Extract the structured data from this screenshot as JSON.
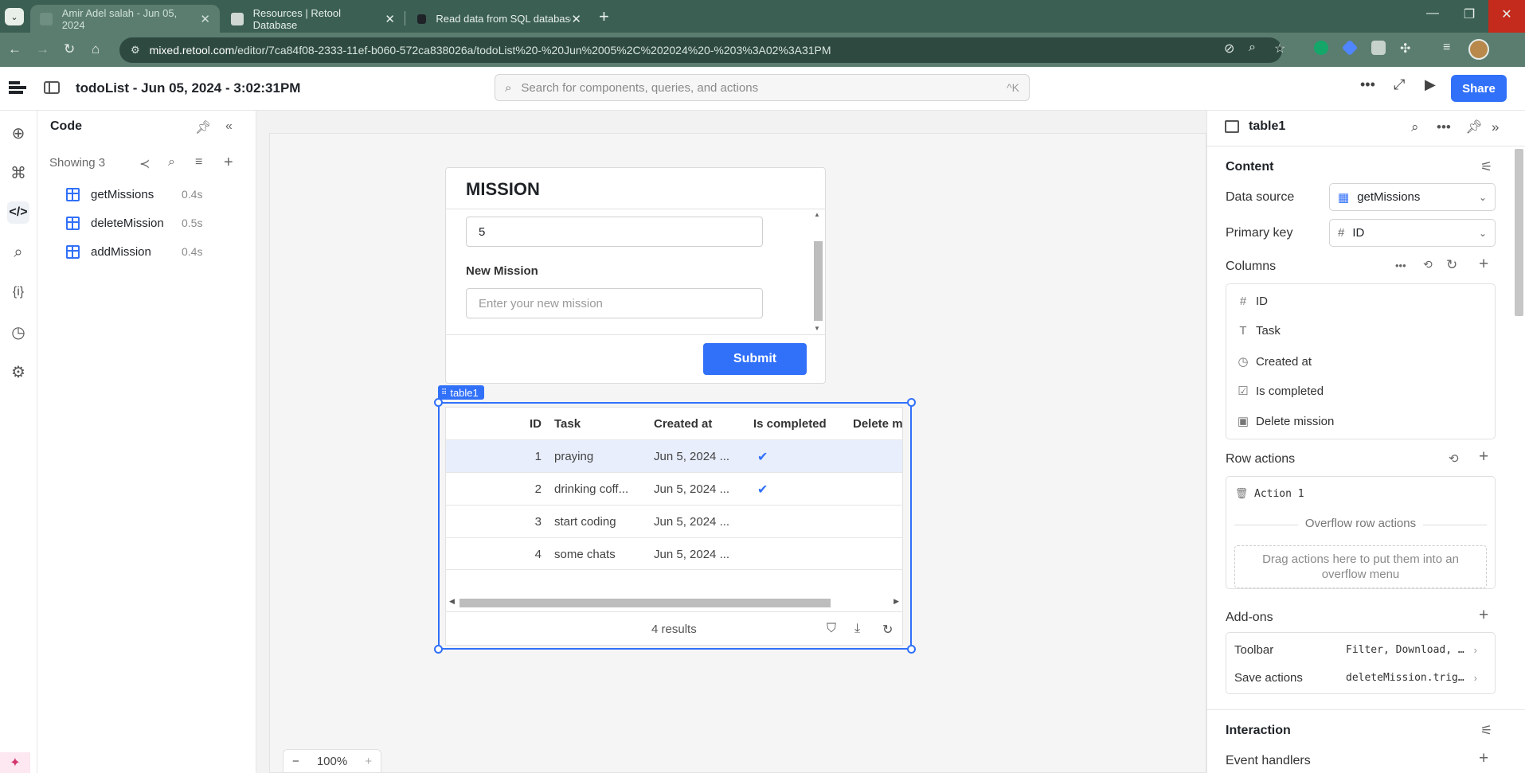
{
  "browser": {
    "tabs": [
      {
        "title": "Amir Adel salah - Jun 05, 2024",
        "active": true
      },
      {
        "title": "Resources | Retool Database",
        "active": false
      },
      {
        "title": "Read data from SQL databases",
        "active": false
      }
    ],
    "url_host": "mixed.retool.com",
    "url_path": "/editor/7ca84f08-2333-11ef-b060-572ca838026a/todoList%20-%20Jun%2005%2C%202024%20-%203%3A02%3A31PM"
  },
  "topbar": {
    "app_title": "todoList - Jun 05, 2024 - 3:02:31PM",
    "search_placeholder": "Search for components, queries, and actions",
    "search_shortcut": "^K",
    "share_label": "Share"
  },
  "code_panel": {
    "title": "Code",
    "showing": "Showing 3",
    "queries": [
      {
        "name": "getMissions",
        "time": "0.4s"
      },
      {
        "name": "deleteMission",
        "time": "0.5s"
      },
      {
        "name": "addMission",
        "time": "0.4s"
      }
    ]
  },
  "form": {
    "title": "MISSION",
    "first_value": "5",
    "new_mission_label": "New Mission",
    "new_mission_placeholder": "Enter your new mission",
    "submit_label": "Submit"
  },
  "table": {
    "tag": "table1",
    "columns": [
      "ID",
      "Task",
      "Created at",
      "Is completed",
      "Delete m"
    ],
    "rows": [
      {
        "id": "1",
        "task": "praying",
        "created": "Jun 5, 2024 ...",
        "completed": true
      },
      {
        "id": "2",
        "task": "drinking coff...",
        "created": "Jun 5, 2024 ...",
        "completed": true
      },
      {
        "id": "3",
        "task": "start coding",
        "created": "Jun 5, 2024 ...",
        "completed": false
      },
      {
        "id": "4",
        "task": "some chats",
        "created": "Jun 5, 2024 ...",
        "completed": false
      }
    ],
    "results": "4 results"
  },
  "zoom": {
    "minus": "−",
    "level": "100%",
    "plus": "+"
  },
  "inspector": {
    "title": "table1",
    "content_title": "Content",
    "data_source_label": "Data source",
    "data_source_value": "getMissions",
    "primary_key_label": "Primary key",
    "primary_key_value": "ID",
    "columns_title": "Columns",
    "columns": [
      {
        "icon": "hash-icon",
        "glyph": "#",
        "label": "ID"
      },
      {
        "icon": "text-icon",
        "glyph": "T",
        "label": "Task"
      },
      {
        "icon": "datetime-icon",
        "glyph": "◷",
        "label": "Created at"
      },
      {
        "icon": "checkbox-icon",
        "glyph": "☑",
        "label": "Is completed"
      },
      {
        "icon": "image-icon",
        "glyph": "▣",
        "label": "Delete mission"
      }
    ],
    "row_actions_title": "Row actions",
    "action_1": "Action 1",
    "overflow_label": "Overflow row actions",
    "dropzone_text": "Drag actions here to put them into an overflow menu",
    "addons_title": "Add-ons",
    "toolbar_label": "Toolbar",
    "toolbar_value": "Filter, Download, …",
    "save_actions_label": "Save actions",
    "save_actions_value": "deleteMission.trig…",
    "interaction_title": "Interaction",
    "event_handlers_label": "Event handlers"
  },
  "colors": {
    "accent": "#3170f9",
    "browser_tab_bar": "#3b5f53"
  }
}
